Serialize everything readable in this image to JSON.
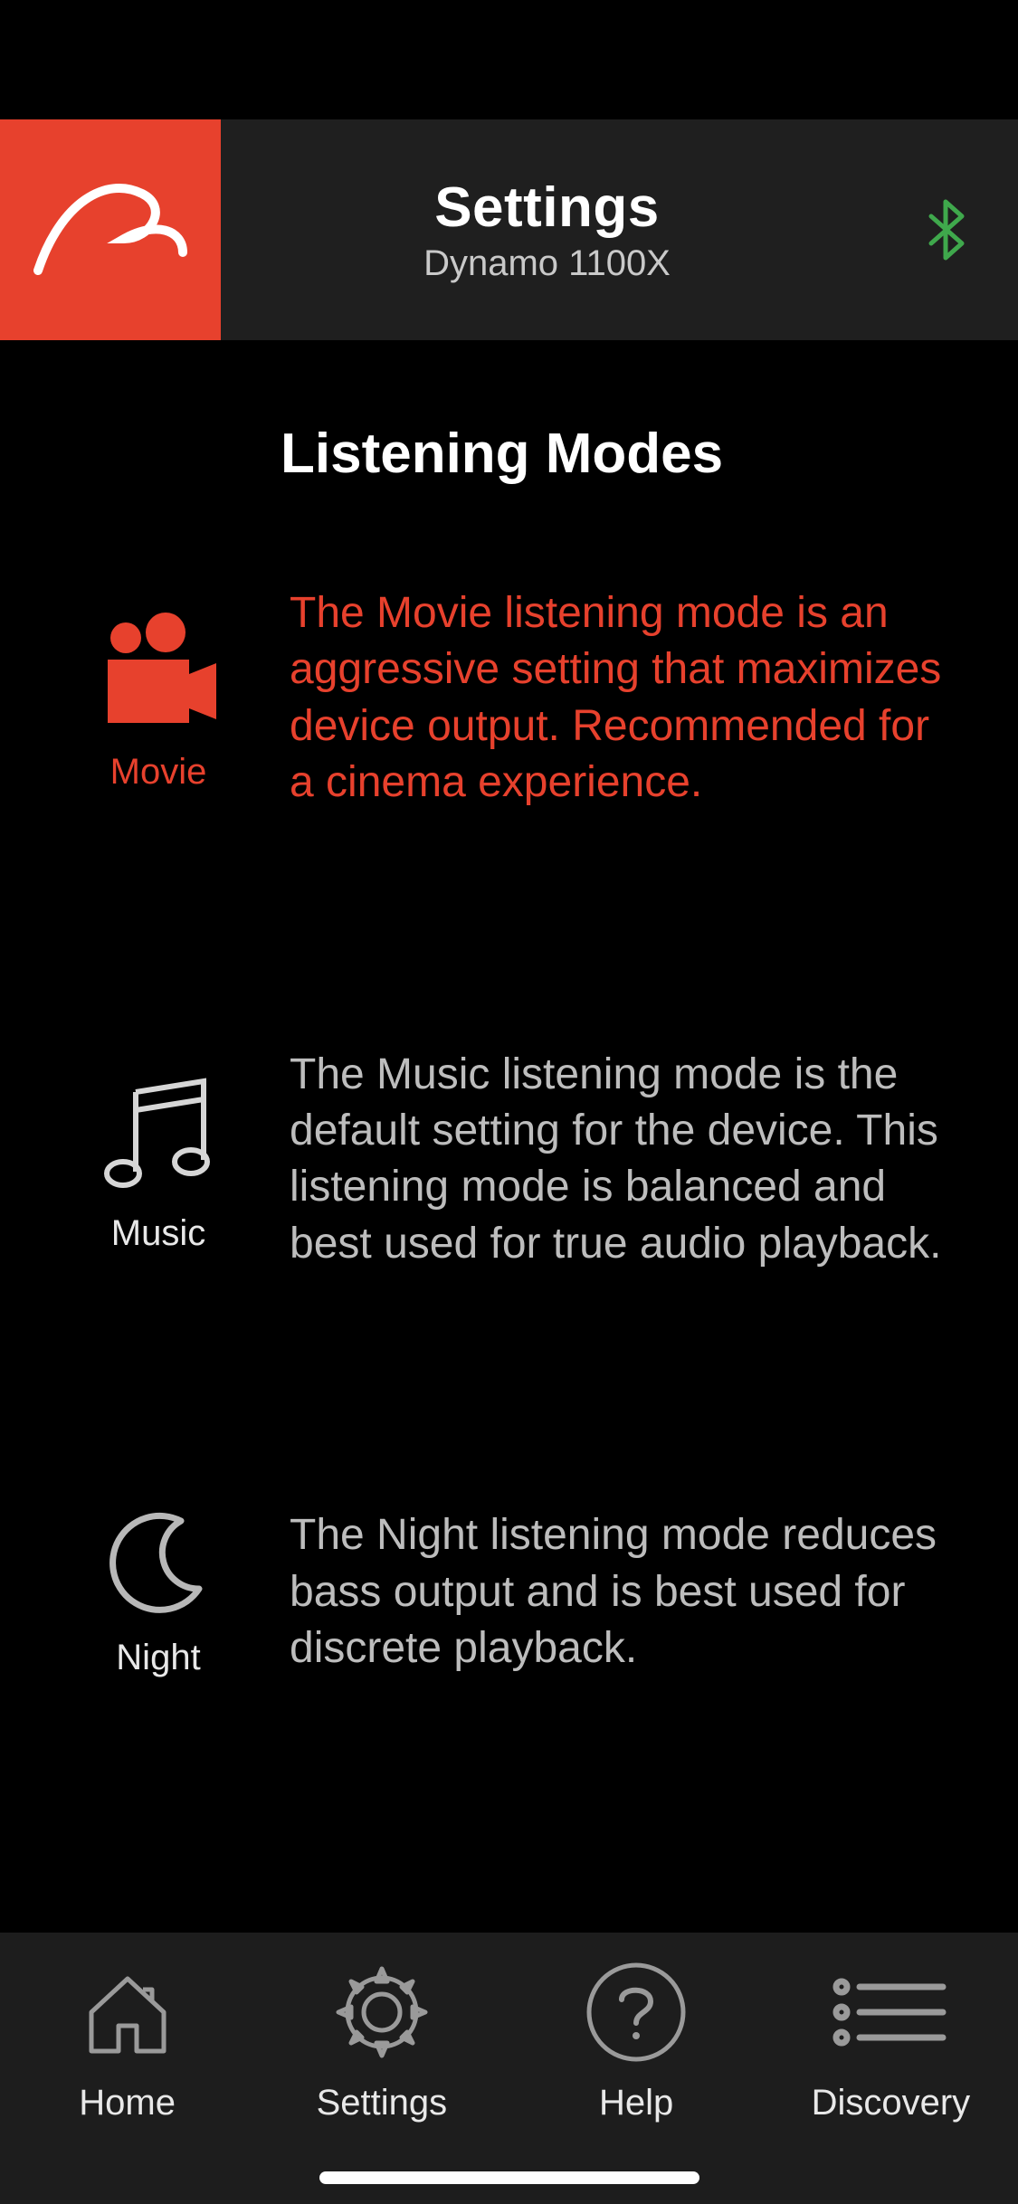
{
  "header": {
    "title": "Settings",
    "subtitle": "Dynamo 1100X"
  },
  "section": {
    "title": "Listening Modes"
  },
  "modes": {
    "movie": {
      "label": "Movie",
      "description": "The Movie listening mode is an aggressive setting that maximizes device output. Recommended for a cinema experience.",
      "active": true
    },
    "music": {
      "label": "Music",
      "description": "The Music listening mode is the default setting for the device. This listening mode is balanced and best used for true audio playback.",
      "active": false
    },
    "night": {
      "label": "Night",
      "description": "The Night listening mode reduces bass output and is best used for discrete playback.",
      "active": false
    }
  },
  "nav": {
    "home": "Home",
    "settings": "Settings",
    "help": "Help",
    "discovery": "Discovery"
  },
  "colors": {
    "accent": "#e7412d",
    "bt": "#3fa84c"
  }
}
